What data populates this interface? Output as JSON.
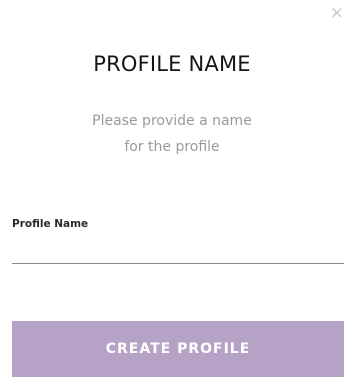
{
  "dialog": {
    "close_glyph": "×",
    "close_icon": "close-icon",
    "title": "PROFILE NAME",
    "subtitle_line1": "Please provide a name",
    "subtitle_line2": "for the profile",
    "field_label": "Profile Name",
    "field_value": "",
    "field_placeholder": "",
    "create_button_label": "CREATE PROFILE",
    "accent_color": "#b7a2c7"
  }
}
